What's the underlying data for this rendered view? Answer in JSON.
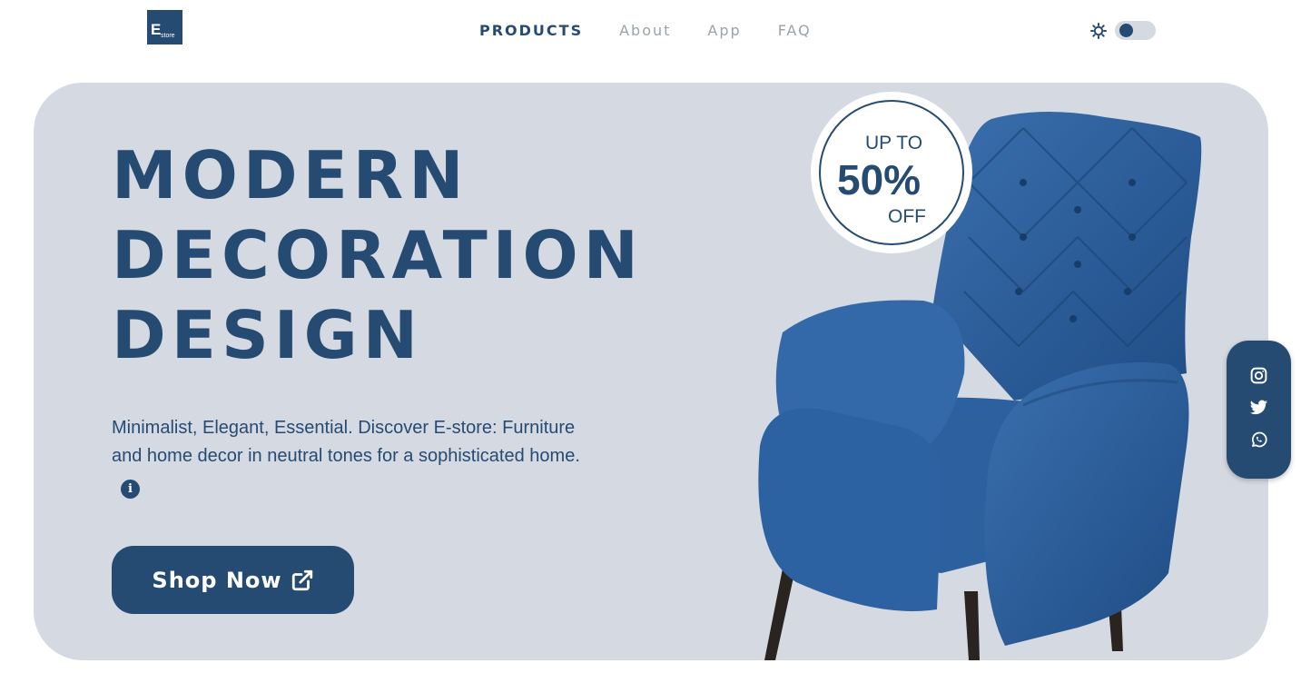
{
  "logo": {
    "big": "E",
    "small": "store"
  },
  "nav": [
    {
      "label": "PRODUCTS",
      "active": true
    },
    {
      "label": "About"
    },
    {
      "label": "App"
    },
    {
      "label": "FAQ"
    }
  ],
  "theme_toggle": {
    "icon": "sun-icon",
    "state": "off"
  },
  "hero": {
    "headline": [
      "MODERN",
      "DECORATION",
      "DESIGN"
    ],
    "description": "Minimalist, Elegant, Essential. Discover E-store: Furniture and home decor in neutral tones for a sophisticated home.",
    "info_icon": "i",
    "cta_label": "Shop Now",
    "cta_icon": "external-link-icon"
  },
  "badge": {
    "top": "UP TO",
    "value": "50%",
    "bottom": "OFF"
  },
  "social": [
    "instagram-icon",
    "twitter-icon",
    "whatsapp-icon"
  ],
  "colors": {
    "primary": "#264b73",
    "hero_bg": "#d5dae2",
    "chair": "#2a5a93",
    "muted_nav": "#9aa2ad"
  }
}
